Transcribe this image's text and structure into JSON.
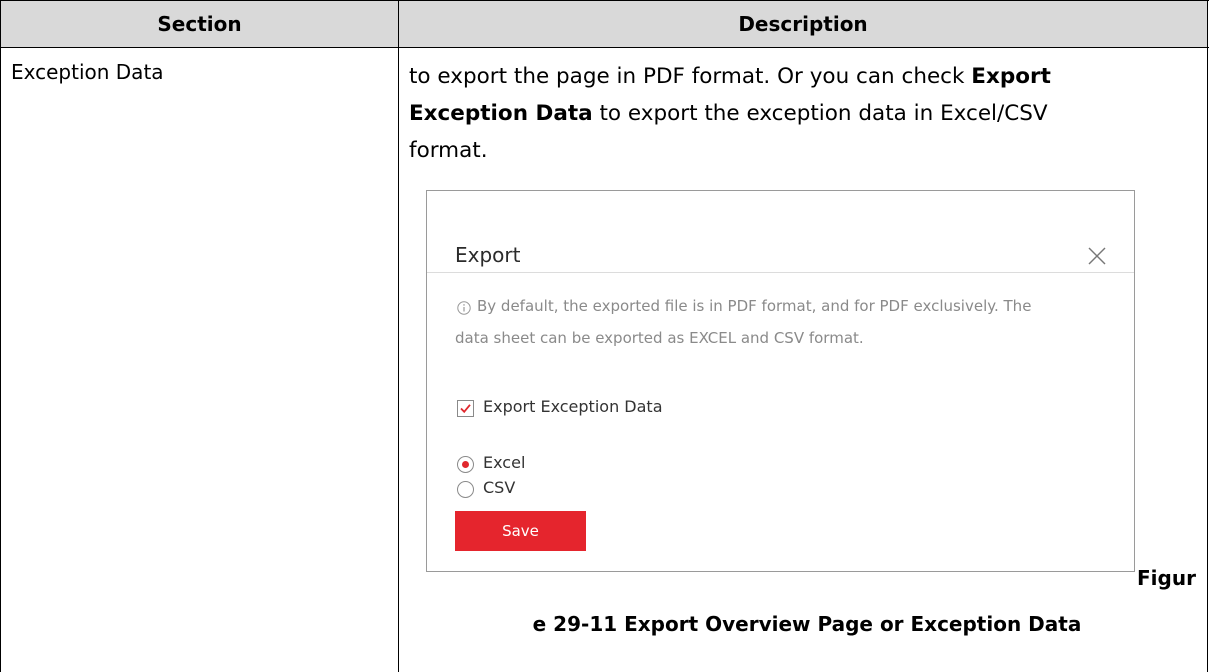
{
  "table": {
    "headers": {
      "section": "Section",
      "description": "Description"
    },
    "row": {
      "section": "Exception Data",
      "description": {
        "t1": "to export the page in PDF format. Or you can check ",
        "b1": "Export",
        "b2": "Exception Data",
        "t2": " to export the exception data in Excel/CSV",
        "t3": "format."
      }
    }
  },
  "dialog": {
    "title": "Export",
    "close_icon": "close-icon",
    "info_icon": "info-circle-icon",
    "info_line1": "By default, the exported file is in PDF format, and for PDF exclusively. The",
    "info_line2": "data sheet can be exported as EXCEL and CSV format.",
    "checkbox_label": "Export Exception Data",
    "checkbox_checked": true,
    "radio_options": [
      "Excel",
      "CSV"
    ],
    "radio_selected": "Excel",
    "save_label": "Save",
    "accent_color": "#e5252d"
  },
  "caption": {
    "part1": "Figur",
    "part2": "e 29-11 Export Overview Page or Exception Data"
  }
}
